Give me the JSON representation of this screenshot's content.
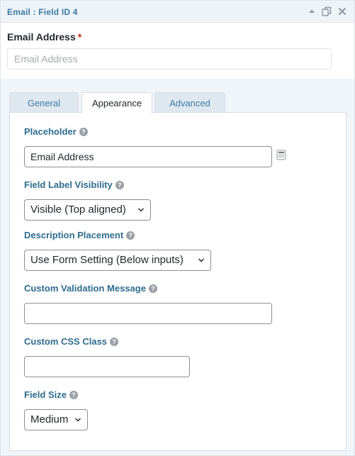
{
  "header": {
    "title": "Email : Field ID 4",
    "icons": [
      "collapse-arrow-icon",
      "duplicate-icon",
      "delete-icon"
    ]
  },
  "preview": {
    "label": "Email Address",
    "required_marker": "*",
    "placeholder": "Email Address"
  },
  "tabs": [
    {
      "label": "General",
      "active": false
    },
    {
      "label": "Appearance",
      "active": true
    },
    {
      "label": "Advanced",
      "active": false
    }
  ],
  "appearance": {
    "placeholder": {
      "label": "Placeholder",
      "value": "Email Address"
    },
    "label_visibility": {
      "label": "Field Label Visibility",
      "selected": "Visible (Top aligned)"
    },
    "description_placement": {
      "label": "Description Placement",
      "selected": "Use Form Setting (Below inputs)"
    },
    "validation_message": {
      "label": "Custom Validation Message",
      "value": ""
    },
    "css_class": {
      "label": "Custom CSS Class",
      "value": ""
    },
    "field_size": {
      "label": "Field Size",
      "selected": "Medium"
    },
    "help_glyph": "?"
  },
  "colors": {
    "accent": "#3d7ba6",
    "setting_label": "#2e6d8f",
    "required": "#c02b0a",
    "settings_bg": "#f0f5fa"
  }
}
